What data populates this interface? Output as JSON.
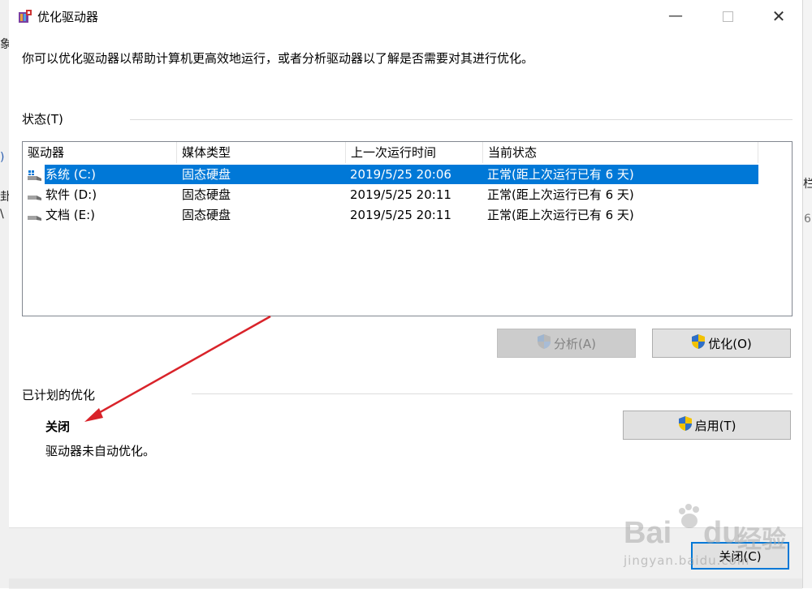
{
  "window": {
    "title": "优化驱动器",
    "description": "你可以优化驱动器以帮助计算机更高效地运行，或者分析驱动器以了解是否需要对其进行优化。"
  },
  "status_section": {
    "label": "状态(T)",
    "columns": [
      "驱动器",
      "媒体类型",
      "上一次运行时间",
      "当前状态"
    ],
    "rows": [
      {
        "drive": "系统 (C:)",
        "media": "固态硬盘",
        "last_run": "2019/5/25 20:06",
        "status": "正常(距上次运行已有 6 天)",
        "selected": true,
        "icon": "system-drive-icon"
      },
      {
        "drive": "软件 (D:)",
        "media": "固态硬盘",
        "last_run": "2019/5/25 20:11",
        "status": "正常(距上次运行已有 6 天)",
        "selected": false,
        "icon": "drive-icon"
      },
      {
        "drive": "文档 (E:)",
        "media": "固态硬盘",
        "last_run": "2019/5/25 20:11",
        "status": "正常(距上次运行已有 6 天)",
        "selected": false,
        "icon": "drive-icon"
      }
    ]
  },
  "buttons": {
    "analyze": "分析(A)",
    "optimize": "优化(O)",
    "enable": "启用(T)",
    "close": "关闭(C)"
  },
  "schedule_section": {
    "label": "已计划的优化",
    "state": "关闭",
    "detail": "驱动器未自动优化。"
  },
  "background_fragments": {
    "left_1": "象",
    "left_2": ")",
    "left_3": "卦",
    "left_4": "\\",
    "right_1": "栏",
    "right_2": "6"
  },
  "watermark": {
    "brand": "Bai",
    "brand2": "du",
    "cn": "经验",
    "url": "jingyan.baidu.com"
  },
  "colors": {
    "selection": "#0078d7",
    "annotation_arrow": "#d9232a",
    "window_bg": "#ffffff",
    "footer_bg": "#f0f0f0"
  }
}
